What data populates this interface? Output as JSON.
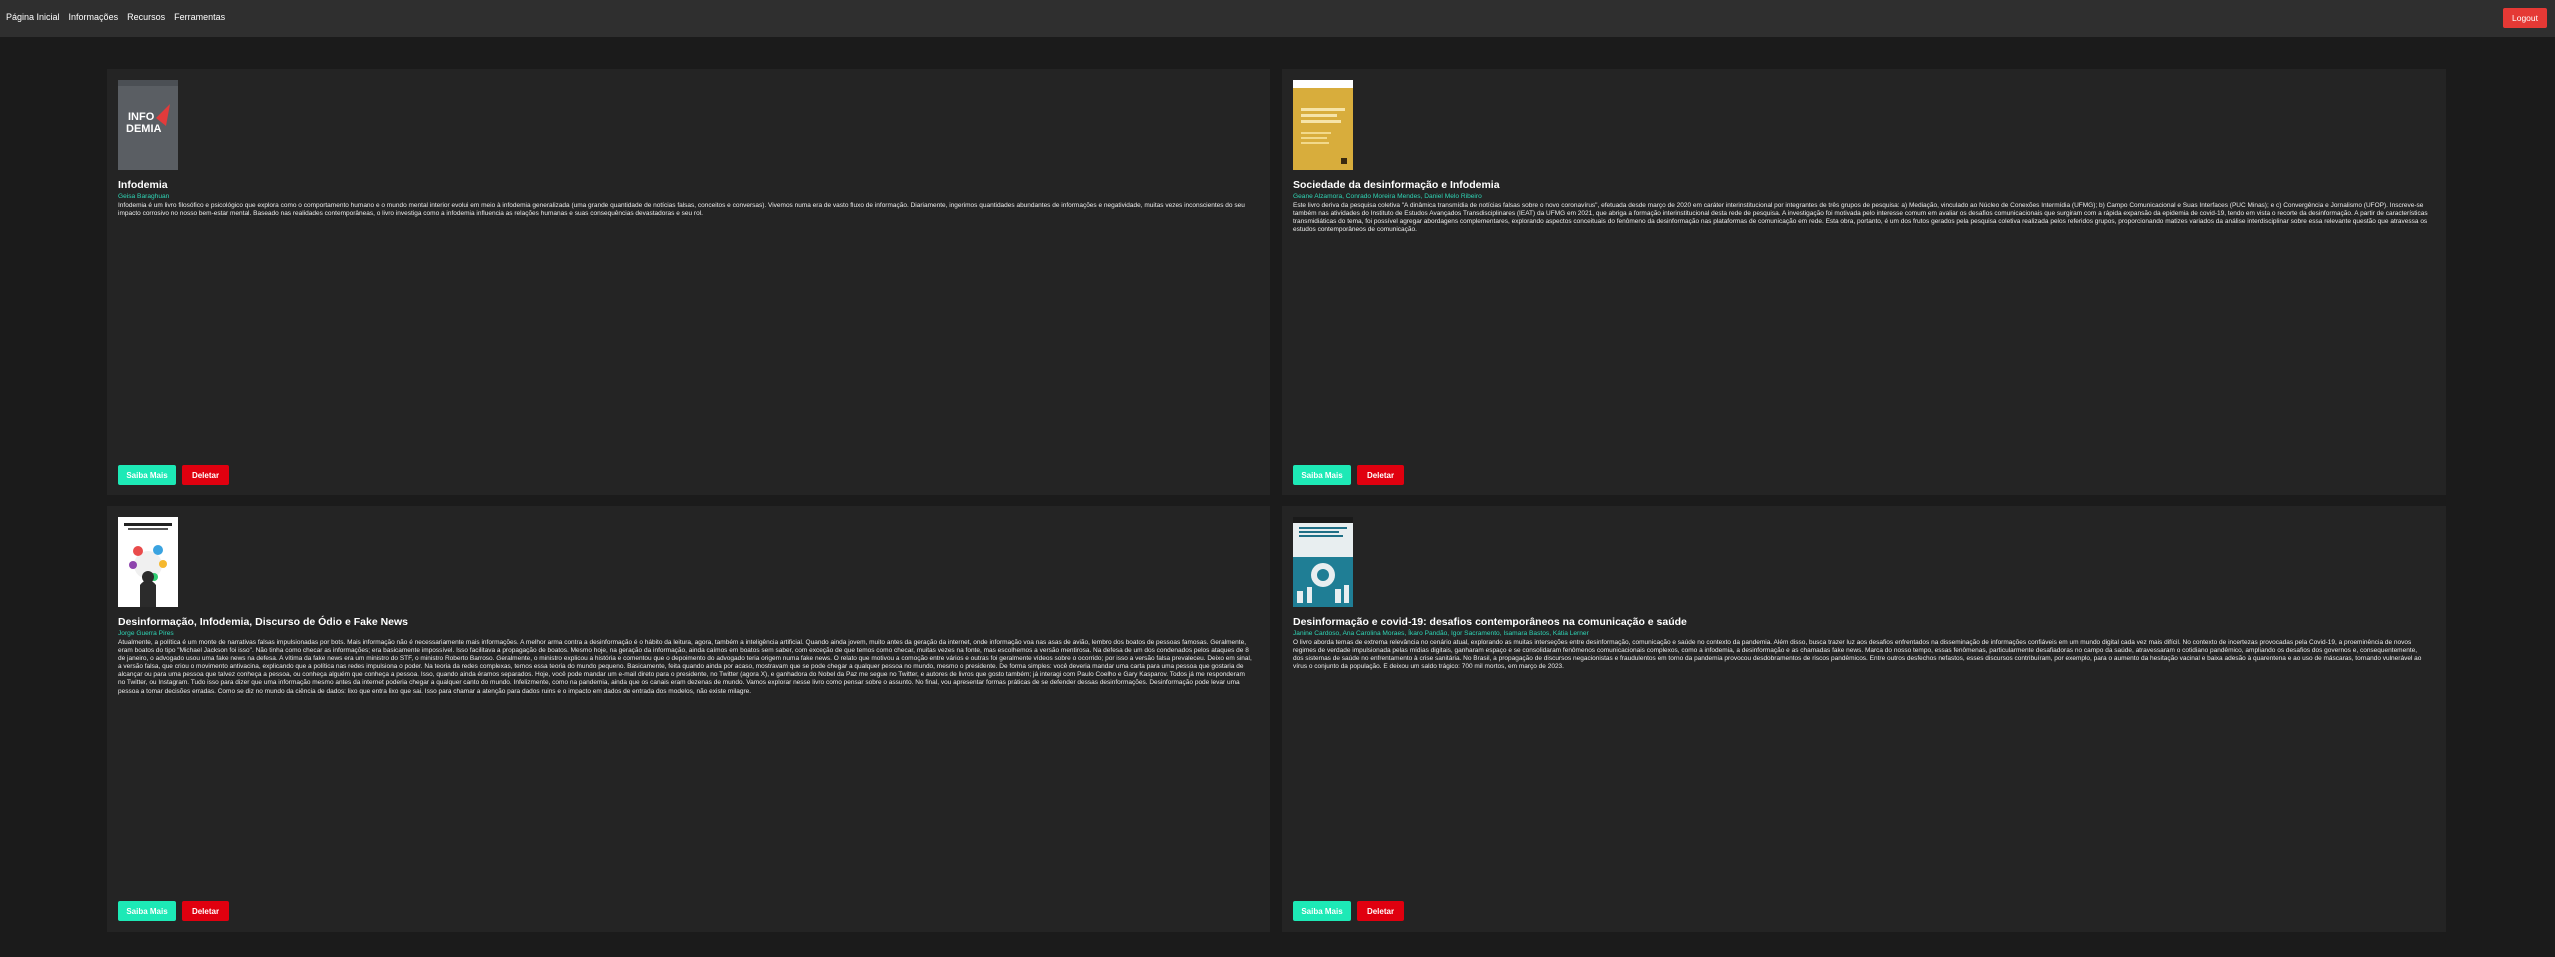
{
  "nav": {
    "links": [
      "Página Inicial",
      "Informações",
      "Recursos",
      "Ferramentas"
    ],
    "logout_label": "Logout"
  },
  "books": [
    {
      "title": "Infodemia",
      "authors": "Geisa Baraghuan",
      "cover_text": "INFO DEMIA",
      "description": "Infodemia é um livro filosófico e psicológico que explora como o comportamento humano e o mundo mental interior evolui em meio à infodemia generalizada (uma grande quantidade de notícias falsas, conceitos e conversas). Vivemos numa era de vasto fluxo de informação. Diariamente, ingerimos quantidades abundantes de informações e negatividade, muitas vezes inconscientes do seu impacto corrosivo no nosso bem-estar mental. Baseado nas realidades contemporâneas, o livro investiga como a infodemia influencia as relações humanas e suas consequências devastadoras e seu rol.",
      "more_label": "Saiba Mais",
      "delete_label": "Deletar"
    },
    {
      "title": "Sociedade da desinformação e Infodemia",
      "authors": "Geane Alzamora, Conrado Moreira Mendes, Daniel Melo Ribeiro",
      "cover_text": "Sociedade da Desinformação e Infodemia",
      "description": "Este livro deriva da pesquisa coletiva \"A dinâmica transmídia de notícias falsas sobre o novo coronavírus\", efetuada desde março de 2020 em caráter interinstitucional por integrantes de três grupos de pesquisa: a) Mediação, vinculado ao Núcleo de Conexões Intermídia (UFMG); b) Campo Comunicacional e Suas Interfaces (PUC Minas); e c) Convergência e Jornalismo (UFOP). Inscreve-se também nas atividades do Instituto de Estudos Avançados Transdisciplinares (IEAT) da UFMG em 2021, que abriga a formação interinstitucional desta rede de pesquisa. A investigação foi motivada pelo interesse comum em avaliar os desafios comunicacionais que surgiram com a rápida expansão da epidemia de covid-19, tendo em vista o recorte da desinformação. A partir de características transmidiáticas do tema, foi possível agregar abordagens complementares, explorando aspectos conceituais do fenômeno da desinformação nas plataformas de comunicação em rede. Esta obra, portanto, é um dos frutos gerados pela pesquisa coletiva realizada pelos referidos grupos, proporcionando matizes variados da análise interdisciplinar sobre essa relevante questão que atravessa os estudos contemporâneos de comunicação.",
      "more_label": "Saiba Mais",
      "delete_label": "Deletar"
    },
    {
      "title": "Desinformação, Infodemia, Discurso de Ódio e Fake News",
      "authors": "Jorge Guerra Pires",
      "cover_text": "DESINFORMAÇÃO, INFODEMIA",
      "description": "Atualmente, a política é um monte de narrativas falsas impulsionadas por bots. Mais informação não é necessariamente mais informações. A melhor arma contra a desinformação é o hábito da leitura, agora, também a inteligência artificial. Quando ainda jovem, muito antes da geração da internet, onde informação voa nas asas de avião, lembro dos boatos de pessoas famosas. Geralmente, eram boatos do tipo \"Michael Jackson foi isso\". Não tinha como checar as informações; era basicamente impossível. Isso facilitava a propagação de boatos. Mesmo hoje, na geração da informação, ainda caímos em boatos sem saber, com exceção de que temos como checar, muitas vezes na fonte, mas escolhemos a versão mentirosa. Na defesa de um dos condenados pelos ataques de 8 de janeiro, o advogado usou uma fake news na defesa. A vítima da fake news era um ministro do STF, o ministro Roberto Barroso. Geralmente, o ministro explicou a história e comentou que o depoimento do advogado teria origem numa fake news. O relato que motivou a comoção entre vários e outras foi geralmente vídeos sobre o ocorrido; por isso a versão falsa prevaleceu. Deixo em sinal, a versão falsa, que criou o movimento antivacina, explicando que a política nas redes impulsiona o poder. Na teoria da redes complexas, temos essa teoria do mundo pequeno. Basicamente, feita quando ainda por acaso, mostravam que se pode chegar a qualquer pessoa no mundo, mesmo o presidente. De forma simples: você deveria mandar uma carta para uma pessoa que gostaria de alcançar ou para uma pessoa que talvez conheça a pessoa, ou conheça alguém que conheça a pessoa. Isso, quando ainda éramos separados. Hoje, você pode mandar um e-mail direto para o presidente, no Twitter (agora X), e ganhadora do Nobel da Paz me segue no Twitter, e autores de livros que gosto também; já interagi com Paulo Coelho e Gary Kasparov. Todos já me responderam no Twitter, ou Instagram. Tudo isso para dizer que uma informação mesmo antes da internet poderia chegar a qualquer canto do mundo. Infelizmente, como na pandemia, ainda que os canais eram dezenas de mundo. Vamos explorar nesse livro como pensar sobre o assunto. No final, vou apresentar formas práticas de se defender dessas desinformações. Desinformação pode levar uma pessoa a tomar decisões erradas. Como se diz no mundo da ciência de dados: lixo que entra lixo que sai. Isso para chamar a atenção para dados ruins e o impacto em dados de entrada dos modelos, não existe milagre.",
      "more_label": "Saiba Mais",
      "delete_label": "Deletar"
    },
    {
      "title": "Desinformação e covid-19: desafios contemporâneos na comunicação e saúde",
      "authors": "Janine Cardoso, Ana Carolina Moraes, Íkaro Pandão, Igor Sacramento, Isamara Bastos, Kátia Lerner",
      "cover_text": "Desinformação e covid-19",
      "description": "O livro aborda temas de extrema relevância no cenário atual, explorando as muitas interseções entre desinformação, comunicação e saúde no contexto da pandemia. Além disso, busca trazer luz aos desafios enfrentados na disseminação de informações confiáveis em um mundo digital cada vez mais difícil. No contexto de incertezas provocadas pela Covid-19, a proeminência de novos regimes de verdade impulsionada pelas mídias digitais, ganharam espaço e se consolidaram fenômenos comunicacionais complexos, como a infodemia, a desinformação e as chamadas fake news. Marca do nosso tempo, essas fenômenas, particularmente desafiadoras no campo da saúde, atravessaram o cotidiano pandêmico, ampliando os desafios dos governos e, consequentemente, dos sistemas de saúde no enfrentamento à crise sanitária. No Brasil, a propagação de discursos negacionistas e fraudulentos em torno da pandemia provocou desdobramentos de riscos pandêmicos. Entre outros desfechos nefastos, esses discursos contribuíram, por exemplo, para o aumento da hesitação vacinal e baixa adesão à quarentena e ao uso de máscaras, tornando vulnerável ao vírus o conjunto da população. E deixou um saldo trágico: 700 mil mortos, em março de 2023.",
      "more_label": "Saiba Mais",
      "delete_label": "Deletar"
    }
  ]
}
